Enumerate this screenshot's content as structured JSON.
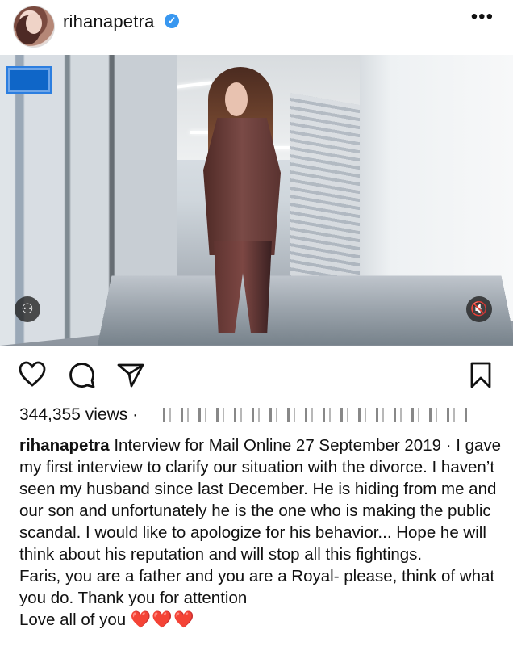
{
  "post": {
    "username": "rihanapetra",
    "verified": "✓",
    "more": "•••",
    "views": "344,355 views ·",
    "caption": {
      "username": "rihanapetra",
      "paragraph1": " Interview for Mail Online 27 September 2019 · I gave my first interview to clarify our situation with the divorce. I haven’t seen my husband since last December. He is hiding from me and our son and unfortunately he is the one who is making the public scandal. I would like to apologize for his behavior... Hope he will think about his reputation and will stop all this fightings.",
      "paragraph2": "Faris, you are a father and you are a Royal- please, think of what you do. Thank you for attention",
      "paragraph3": "Love all of you ",
      "hearts": "❤️❤️❤️"
    },
    "media_controls": {
      "left_icon": "⚇",
      "right_icon": "🔇"
    }
  }
}
